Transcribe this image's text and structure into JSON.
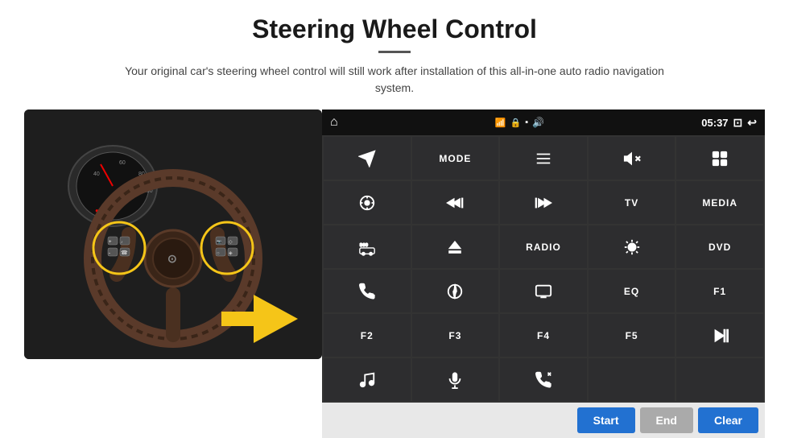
{
  "page": {
    "title": "Steering Wheel Control",
    "subtitle": "Your original car's steering wheel control will still work after installation of this all-in-one auto radio navigation system."
  },
  "status_bar": {
    "home_icon": "⌂",
    "wifi_icon": "wifi",
    "lock_icon": "🔒",
    "sd_icon": "SD",
    "bt_icon": "bt",
    "time": "05:37",
    "screen_icon": "⊡",
    "back_icon": "↩"
  },
  "grid_buttons": [
    {
      "id": "r1c1",
      "type": "icon",
      "icon": "send",
      "label": "send"
    },
    {
      "id": "r1c2",
      "type": "text",
      "label": "MODE"
    },
    {
      "id": "r1c3",
      "type": "icon",
      "icon": "list",
      "label": "list"
    },
    {
      "id": "r1c4",
      "type": "icon",
      "icon": "mute",
      "label": "mute"
    },
    {
      "id": "r1c5",
      "type": "icon",
      "icon": "grid",
      "label": "grid"
    },
    {
      "id": "r2c1",
      "type": "icon",
      "icon": "settings-circle",
      "label": "settings"
    },
    {
      "id": "r2c2",
      "type": "icon",
      "icon": "prev",
      "label": "previous"
    },
    {
      "id": "r2c3",
      "type": "icon",
      "icon": "next",
      "label": "next"
    },
    {
      "id": "r2c4",
      "type": "text",
      "label": "TV"
    },
    {
      "id": "r2c5",
      "type": "text",
      "label": "MEDIA"
    },
    {
      "id": "r3c1",
      "type": "icon",
      "icon": "360-car",
      "label": "360 cam"
    },
    {
      "id": "r3c2",
      "type": "icon",
      "icon": "eject",
      "label": "eject"
    },
    {
      "id": "r3c3",
      "type": "text",
      "label": "RADIO"
    },
    {
      "id": "r3c4",
      "type": "icon",
      "icon": "brightness",
      "label": "brightness"
    },
    {
      "id": "r3c5",
      "type": "text",
      "label": "DVD"
    },
    {
      "id": "r4c1",
      "type": "icon",
      "icon": "phone",
      "label": "phone"
    },
    {
      "id": "r4c2",
      "type": "icon",
      "icon": "navigation",
      "label": "navigation"
    },
    {
      "id": "r4c3",
      "type": "icon",
      "icon": "screen-mirror",
      "label": "screen mirror"
    },
    {
      "id": "r4c4",
      "type": "text",
      "label": "EQ"
    },
    {
      "id": "r4c5",
      "type": "text",
      "label": "F1"
    },
    {
      "id": "r5c1",
      "type": "text",
      "label": "F2"
    },
    {
      "id": "r5c2",
      "type": "text",
      "label": "F3"
    },
    {
      "id": "r5c3",
      "type": "text",
      "label": "F4"
    },
    {
      "id": "r5c4",
      "type": "text",
      "label": "F5"
    },
    {
      "id": "r5c5",
      "type": "icon",
      "icon": "play-pause",
      "label": "play pause"
    },
    {
      "id": "r6c1",
      "type": "icon",
      "icon": "music",
      "label": "music"
    },
    {
      "id": "r6c2",
      "type": "icon",
      "icon": "microphone",
      "label": "microphone"
    },
    {
      "id": "r6c3",
      "type": "icon",
      "icon": "phone-answer",
      "label": "phone answer"
    }
  ],
  "action_bar": {
    "start_label": "Start",
    "end_label": "End",
    "clear_label": "Clear"
  }
}
